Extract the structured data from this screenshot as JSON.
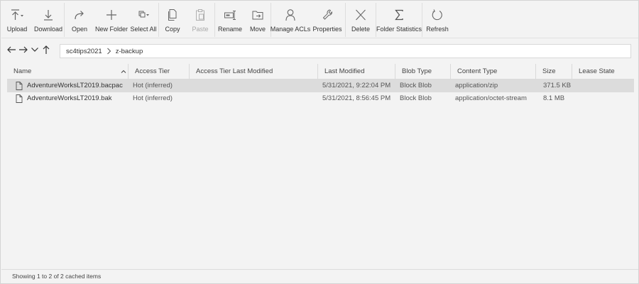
{
  "toolbar": {
    "buttons": [
      {
        "label": "Upload",
        "icon": "upload-icon",
        "enabled": true
      },
      {
        "label": "Download",
        "icon": "download-icon",
        "enabled": true
      },
      {
        "label": "Open",
        "icon": "open-icon",
        "enabled": true
      },
      {
        "label": "New Folder",
        "icon": "plus-icon",
        "enabled": true
      },
      {
        "label": "Select All",
        "icon": "select-all-icon",
        "enabled": true
      },
      {
        "label": "Copy",
        "icon": "copy-icon",
        "enabled": true
      },
      {
        "label": "Paste",
        "icon": "paste-icon",
        "enabled": false
      },
      {
        "label": "Rename",
        "icon": "rename-icon",
        "enabled": true
      },
      {
        "label": "Move",
        "icon": "move-icon",
        "enabled": true
      },
      {
        "label": "Manage ACLs",
        "icon": "person-icon",
        "enabled": true
      },
      {
        "label": "Properties",
        "icon": "wrench-icon",
        "enabled": true
      },
      {
        "label": "Delete",
        "icon": "delete-icon",
        "enabled": true
      },
      {
        "label": "Folder Statistics",
        "icon": "sigma-icon",
        "enabled": true
      },
      {
        "label": "Refresh",
        "icon": "refresh-icon",
        "enabled": true
      }
    ]
  },
  "nav": {
    "breadcrumb": [
      "sc4tips2021",
      "z-backup"
    ]
  },
  "table": {
    "columns": [
      "Name",
      "Access Tier",
      "Access Tier Last Modified",
      "Last Modified",
      "Blob Type",
      "Content Type",
      "Size",
      "Lease State"
    ],
    "sort_column": "Name",
    "rows": [
      {
        "name": "AdventureWorksLT2019.bacpac",
        "access_tier": "Hot (inferred)",
        "access_tier_last_modified": "",
        "last_modified": "5/31/2021, 9:22:04 PM",
        "blob_type": "Block Blob",
        "content_type": "application/zip",
        "size": "371.5 KB",
        "lease_state": "",
        "selected": true
      },
      {
        "name": "AdventureWorksLT2019.bak",
        "access_tier": "Hot (inferred)",
        "access_tier_last_modified": "",
        "last_modified": "5/31/2021, 8:56:45 PM",
        "blob_type": "Block Blob",
        "content_type": "application/octet-stream",
        "size": "8.1 MB",
        "lease_state": "",
        "selected": false
      }
    ]
  },
  "status": {
    "text": "Showing 1 to 2 of 2 cached items"
  },
  "colors": {
    "background": "#f3f3f3",
    "selected_row": "#dcdcdc",
    "icon": "#555555",
    "disabled": "#a8a8a8"
  }
}
